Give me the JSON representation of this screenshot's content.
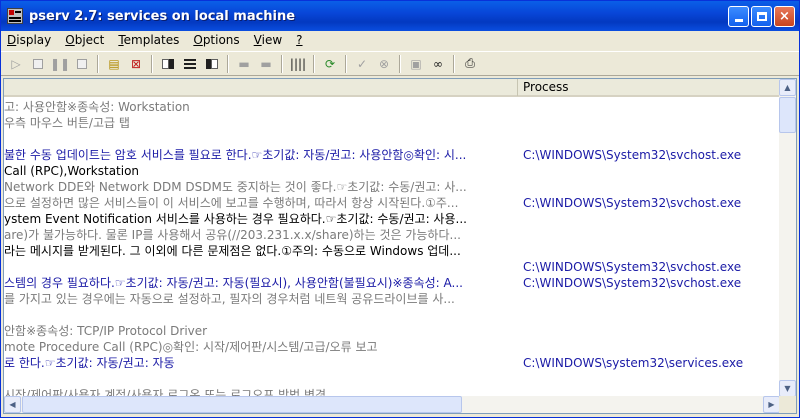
{
  "window": {
    "title": "pserv 2.7: services on local machine"
  },
  "title_buttons": {
    "minimize": "_",
    "maximize": "□",
    "close": "×"
  },
  "menu": [
    {
      "first": "D",
      "rest": "isplay"
    },
    {
      "first": "O",
      "rest": "bject"
    },
    {
      "first": "T",
      "rest": "emplates"
    },
    {
      "first": "O",
      "rest": "ptions"
    },
    {
      "first": "V",
      "rest": "iew"
    },
    {
      "first": "?",
      "rest": ""
    }
  ],
  "toolbar": {
    "icons": [
      "play-icon",
      "pause-box-icon",
      "pause-icon",
      "stop-icon",
      "properties-new-icon",
      "delete-icon",
      "split-left-icon",
      "bars-icon",
      "bars-fill-icon",
      "dash-icon",
      "dash-bar-icon",
      "barcode-icon",
      "refresh-icon",
      "check-icon",
      "cancel-icon",
      "server-icon",
      "binoculars-icon",
      "printer-icon"
    ]
  },
  "columns": {
    "description": "",
    "process": "Process"
  },
  "rows": [
    {
      "desc": "고: 사용안함※종속성: Workstation",
      "proc": "",
      "style": "grey"
    },
    {
      "desc": "우측 마우스 버튼/고급 탭",
      "proc": "",
      "style": "grey"
    },
    {
      "desc": "",
      "proc": "",
      "style": "grey"
    },
    {
      "desc": "불한 수동 업데이트는 암호 서비스를 필요로 한다.☞초기값: 자동/권고: 사용안함◎확인: 시...",
      "proc": "C:\\WINDOWS\\System32\\svchost.exe",
      "style": "blue"
    },
    {
      "desc": "Call (RPC),Workstation",
      "proc": "",
      "style": "black"
    },
    {
      "desc": "Network DDE와 Network DDM DSDM도 중지하는 것이 좋다.☞초기값: 수동/권고: 사...",
      "proc": "",
      "style": "grey"
    },
    {
      "desc": "으로 설정하면 많은 서비스들이 이 서비스에 보고를 수행하며, 따라서 항상 시작된다.①주...",
      "proc": "C:\\WINDOWS\\System32\\svchost.exe",
      "style": "grey"
    },
    {
      "desc": "ystem Event Notification 서비스를 사용하는 경우 필요하다.☞초기값: 수동/권고: 사용...",
      "proc": "",
      "style": "black"
    },
    {
      "desc": "are)가 불가능하다. 물론 IP를 사용해서 공유(//203.231.x.x/share)하는 것은 가능하다...",
      "proc": "",
      "style": "grey"
    },
    {
      "desc": "라는 메시지를 받게된다. 그 이외에 다른 문제점은 없다.①주의: 수동으로 Windows 업데...",
      "proc": "",
      "style": "black"
    },
    {
      "desc": "",
      "proc": "C:\\WINDOWS\\System32\\svchost.exe",
      "style": "grey"
    },
    {
      "desc": "스템의 경우 필요하다.☞초기값: 자동/권고: 자동(필요시), 사용안함(불필요시)※종속성: A...",
      "proc": "C:\\WINDOWS\\System32\\svchost.exe",
      "style": "blue"
    },
    {
      "desc": "를 가지고 있는 경우에는 자동으로 설정하고, 필자의 경우처럼 네트웍 공유드라이브를 사...",
      "proc": "",
      "style": "grey"
    },
    {
      "desc": "",
      "proc": "",
      "style": "grey"
    },
    {
      "desc": "안함※종속성: TCP/IP Protocol Driver",
      "proc": "",
      "style": "grey"
    },
    {
      "desc": "mote Procedure Call (RPC)◎확인: 시작/제어판/시스템/고급/오류 보고",
      "proc": "",
      "style": "grey"
    },
    {
      "desc": "로 한다.☞초기값: 자동/권고: 자동",
      "proc": "C:\\WINDOWS\\system32\\services.exe",
      "style": "blue"
    },
    {
      "desc": "",
      "proc": "",
      "style": "grey"
    },
    {
      "desc": "시작/제어판/사용자 계정/사용자 로그온 또는 로그오프 방법 변경",
      "proc": "",
      "style": "grey"
    }
  ]
}
